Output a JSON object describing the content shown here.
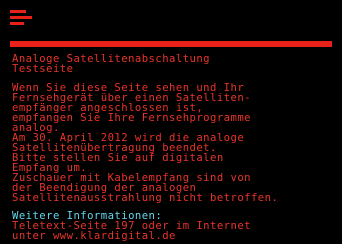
{
  "colors": {
    "accent": "#e8221b",
    "text": "#e8342a",
    "info": "#63d6ea",
    "background": "#000000"
  },
  "logo": {
    "icon": "teletext-red-stripes-logo"
  },
  "page": {
    "title": "Analoge Satellitenabschaltung",
    "subtitle": "Testseite",
    "body_lines": [
      "Wenn Sie diese Seite sehen und Ihr",
      "Fernsehgerät über einen Satelliten-",
      "empfänger angeschlossen ist,",
      "empfangen Sie Ihre Fernsehprogramme",
      "analog.",
      "Am 30. April 2012 wird die analoge",
      "Satellitenübertragung beendet.",
      "Bitte stellen Sie auf digitalen",
      "Empfang um.",
      "Zuschauer mit Kabelempfang sind von",
      "der Beendigung der analogen",
      "Satellitenausstrahlung nicht betroffen."
    ],
    "info_lines": [
      "Weitere Informationen:",
      "Teletext-Seite 197 oder im Internet",
      "unter www.klardigital.de"
    ]
  }
}
